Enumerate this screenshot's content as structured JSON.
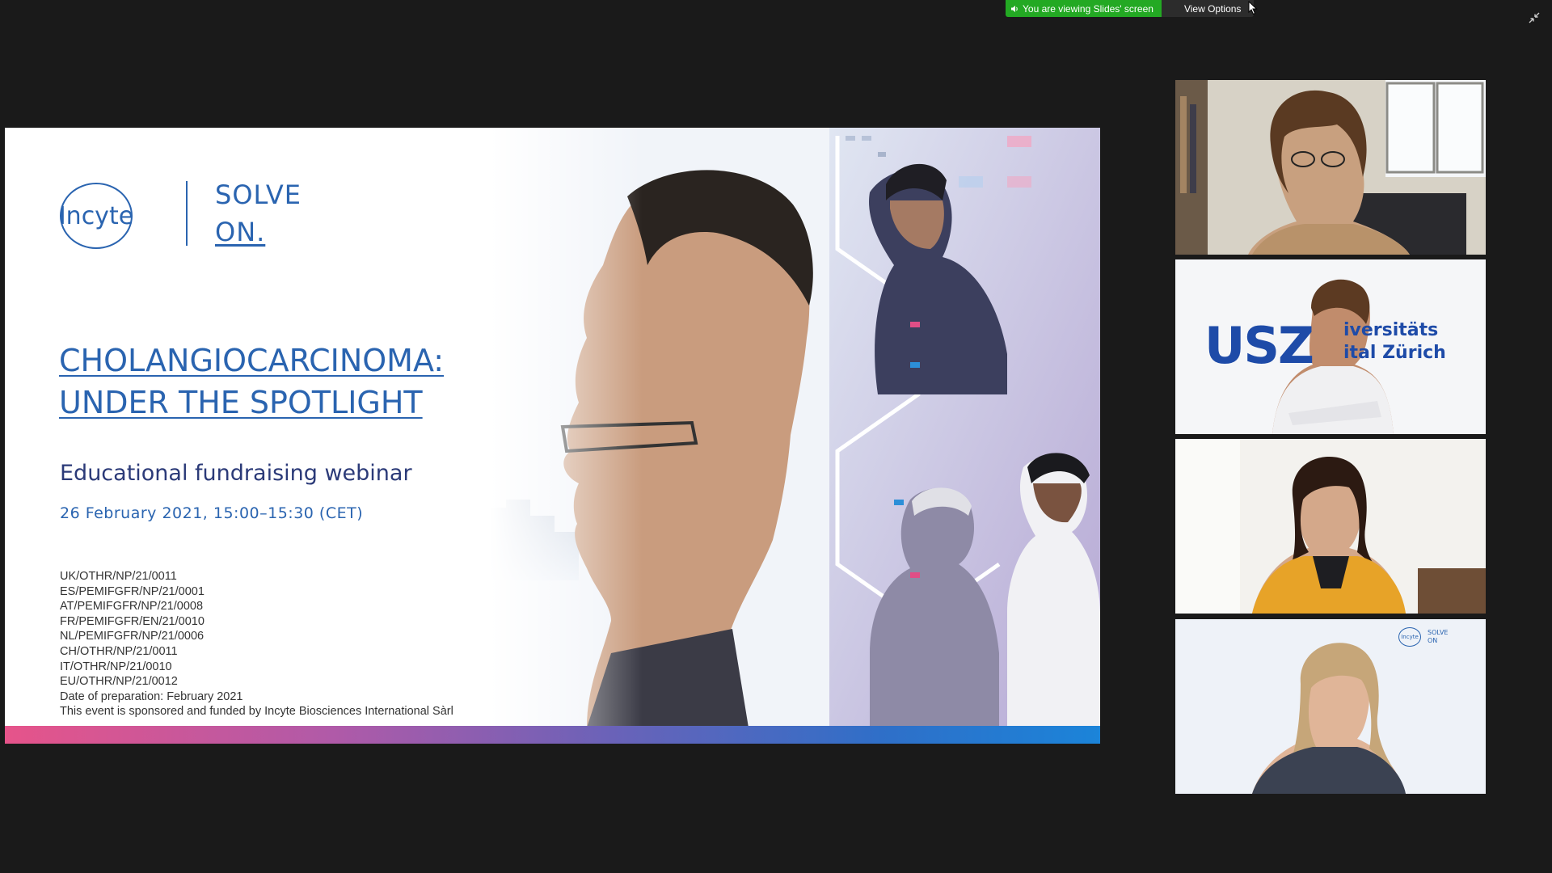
{
  "screen_share": {
    "status_text": "You are viewing Slides' screen",
    "view_options_label": "View Options",
    "status_color": "#23a923"
  },
  "slide": {
    "logo_text": "Incyte",
    "tagline_line1": "SOLVE",
    "tagline_line2": "ON.",
    "title_line1": "CHOLANGIOCARCINOMA:",
    "title_line2": "UNDER THE SPOTLIGHT",
    "subtitle": "Educational fundraising webinar",
    "date": "26 February 2021, 15:00–15:30 (CET)",
    "codes": [
      "UK/OTHR/NP/21/0011",
      "ES/PEMIFGFR/NP/21/0001",
      "AT/PEMIFGFR/NP/21/0008",
      "FR/PEMIFGFR/EN/21/0010",
      "NL/PEMIFGFR/NP/21/0006",
      "CH/OTHR/NP/21/0011",
      "IT/OTHR/NP/21/0010",
      "EU/OTHR/NP/21/0012",
      "Date of preparation: February 2021",
      "This event is sponsored and funded by Incyte Biosciences International Sàrl"
    ],
    "brand_color": "#2a64b0"
  },
  "participants": {
    "tile2_backdrop_line1": "USZ",
    "tile2_backdrop_line2": "iversitäts",
    "tile2_backdrop_line3": "ital Zürich",
    "tile4_logo_text": "Incyte",
    "tile4_tagline_line1": "SOLVE",
    "tile4_tagline_line2": "ON"
  },
  "icons": {
    "speaker": "speaker-icon",
    "chevron": "chevron-down-icon",
    "cursor": "mouse-cursor-icon",
    "exit_fullscreen": "exit-fullscreen-icon"
  }
}
